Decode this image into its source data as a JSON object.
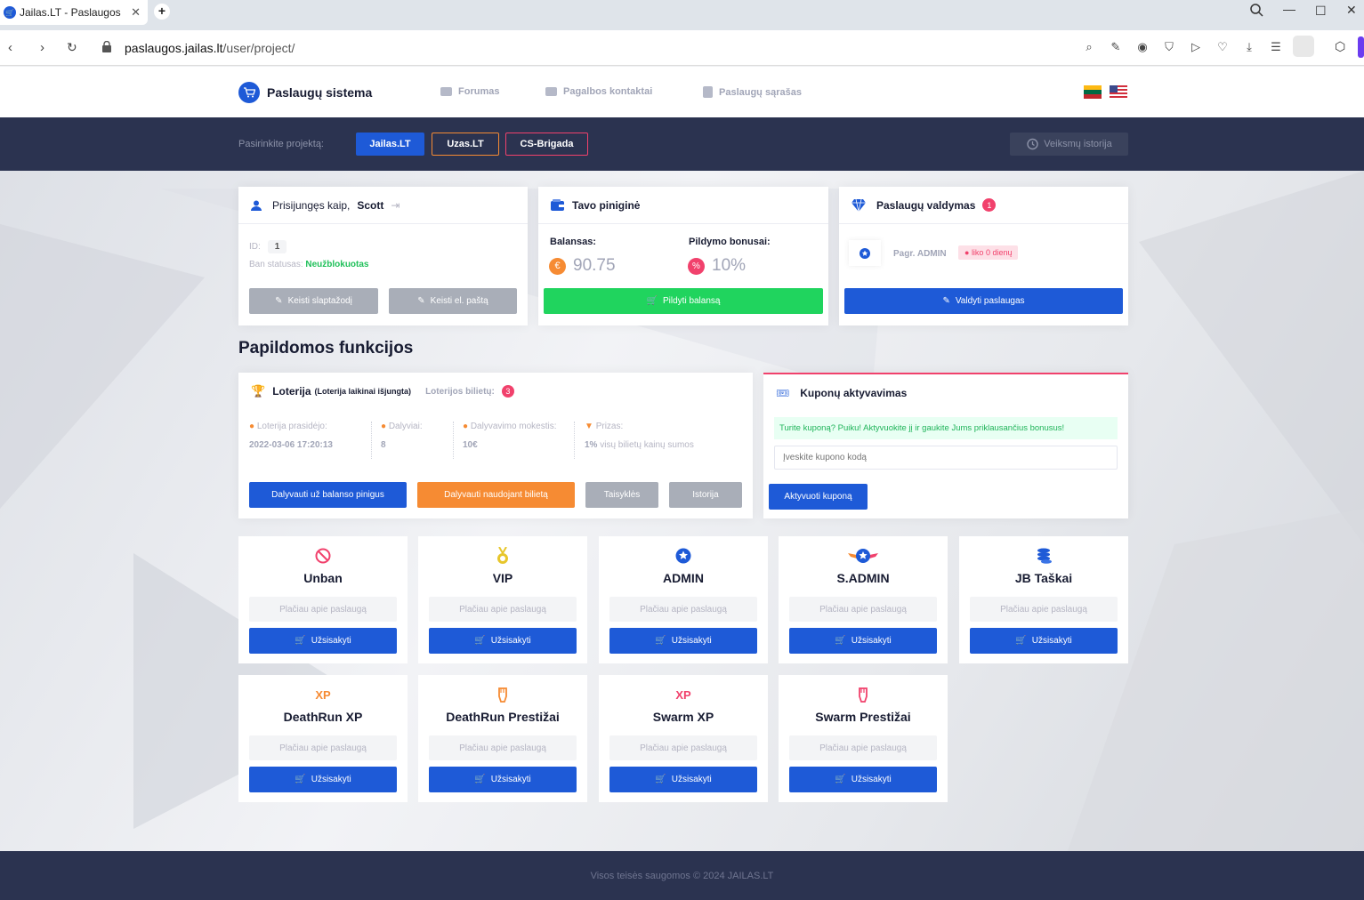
{
  "browser": {
    "tab_title": "Jailas.LT - Paslaugos",
    "url_host": "paslaugos.jailas.lt",
    "url_path": "/user/project/"
  },
  "header": {
    "brand": "Paslaugų sistema",
    "menu": [
      "Forumas",
      "Pagalbos kontaktai",
      "Paslaugų sąrašas"
    ]
  },
  "projects": {
    "label": "Pasirinkite projektą:",
    "items": [
      {
        "name": "Jailas.LT",
        "color": "#1e5ad7"
      },
      {
        "name": "Uzas.LT",
        "color": "#f68b33"
      },
      {
        "name": "CS-Brigada",
        "color": "#f1416c"
      }
    ],
    "history": "Veiksmų istorija"
  },
  "user": {
    "logged_as": "Prisijungęs kaip,",
    "name": "Scott",
    "id_label": "ID:",
    "id_value": "1",
    "ban_label": "Ban statusas:",
    "ban_value": "Neužblokuotas",
    "change_pass": "Keisti slaptažodį",
    "change_email": "Keisti el. paštą"
  },
  "wallet": {
    "title": "Tavo piniginė",
    "balance_label": "Balansas:",
    "balance_value": "90.75",
    "bonus_label": "Pildymo bonusai:",
    "bonus_value": "10%",
    "topup": "Pildyti balansą"
  },
  "services_mgmt": {
    "title": "Paslaugų valdymas",
    "count": "1",
    "service": "Pagr. ADMIN",
    "remaining": "liko 0 dienų",
    "manage": "Valdyti paslaugas"
  },
  "extra_title": "Papildomos funkcijos",
  "lottery": {
    "title": "Loterija",
    "subtitle": "(Loterija laikinai išjungta)",
    "tickets_label": "Loterijos bilietų:",
    "tickets": "3",
    "stats": [
      {
        "label": "Loterija prasidėjo:",
        "value": "2022-03-06 17:20:13"
      },
      {
        "label": "Dalyviai:",
        "value": "8"
      },
      {
        "label": "Dalyvavimo mokestis:",
        "value": "10€"
      },
      {
        "label": "Prizas:",
        "value_bold": "1%",
        "value": " visų bilietų kainų sumos"
      }
    ],
    "btn_balance": "Dalyvauti už balanso pinigus",
    "btn_ticket": "Dalyvauti naudojant bilietą",
    "btn_rules": "Taisyklės",
    "btn_history": "Istorija"
  },
  "coupon": {
    "title": "Kuponų aktyvavimas",
    "notice": "Turite kuponą? Puiku! Aktyvuokite jį ir gaukite Jums priklausančius bonusus!",
    "placeholder": "Įveskite kupono kodą",
    "activate": "Aktyvuoti kuponą"
  },
  "service_cards": [
    {
      "name": "Unban",
      "icon": "ban-icon"
    },
    {
      "name": "VIP",
      "icon": "medal-icon"
    },
    {
      "name": "ADMIN",
      "icon": "star-badge-icon"
    },
    {
      "name": "S.ADMIN",
      "icon": "winged-star-icon"
    },
    {
      "name": "JB Taškai",
      "icon": "coins-icon"
    },
    {
      "name": "DeathRun XP",
      "icon": "xp-icon",
      "icon_text": "XP"
    },
    {
      "name": "DeathRun Prestižai",
      "icon": "fist-icon"
    },
    {
      "name": "Swarm XP",
      "icon": "xp-icon",
      "icon_text": "XP"
    },
    {
      "name": "Swarm Prestižai",
      "icon": "fist-icon"
    }
  ],
  "service_more": "Plačiau apie paslaugą",
  "service_order": "Užsisakyti",
  "footer": "Visos teisės saugomos © 2024 JAILAS.LT",
  "colors": {
    "primary": "#1e5ad7",
    "success": "#20d45e",
    "warning": "#f68b33",
    "danger": "#f1416c",
    "dark": "#2b3350"
  }
}
